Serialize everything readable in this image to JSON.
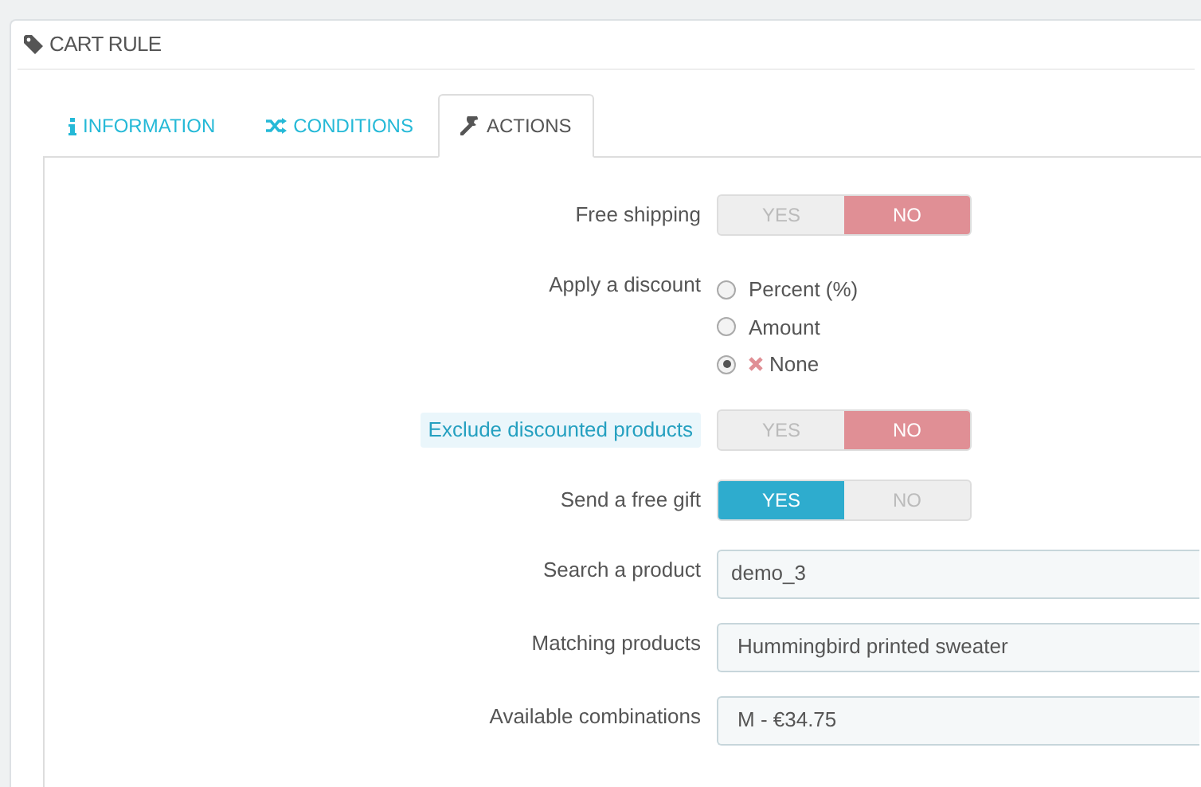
{
  "panel": {
    "title": "CART RULE"
  },
  "tabs": [
    {
      "label": "INFORMATION",
      "selected": false
    },
    {
      "label": "CONDITIONS",
      "selected": false
    },
    {
      "label": "ACTIONS",
      "selected": true
    }
  ],
  "rows": [
    {
      "kind": "switch",
      "label": "Free shipping",
      "highlighted": false,
      "options": [
        {
          "label": "YES",
          "selected": false
        },
        {
          "label": "NO",
          "selected": true
        }
      ]
    },
    {
      "kind": "radio",
      "label": "Apply a discount",
      "highlighted": false,
      "options": [
        {
          "label": "Percent (%)",
          "kind": "plain",
          "selected": false
        },
        {
          "label": "Amount",
          "kind": "plain",
          "selected": false
        },
        {
          "label": "None",
          "kind": "cross",
          "selected": true
        }
      ]
    },
    {
      "kind": "switch",
      "label": "Exclude discounted products",
      "highlighted": true,
      "options": [
        {
          "label": "YES",
          "selected": false
        },
        {
          "label": "NO",
          "selected": true
        }
      ]
    },
    {
      "kind": "switch",
      "label": "Send a free gift",
      "highlighted": false,
      "options": [
        {
          "label": "YES",
          "selected": true
        },
        {
          "label": "NO",
          "selected": false
        }
      ]
    },
    {
      "kind": "input",
      "label": "Search a product",
      "highlighted": false,
      "value": "demo_3"
    },
    {
      "kind": "select",
      "label": "Matching products",
      "highlighted": false,
      "value": "Hummingbird printed sweater"
    },
    {
      "kind": "select",
      "label": "Available combinations",
      "highlighted": false,
      "value": "M - €34.75"
    }
  ]
}
